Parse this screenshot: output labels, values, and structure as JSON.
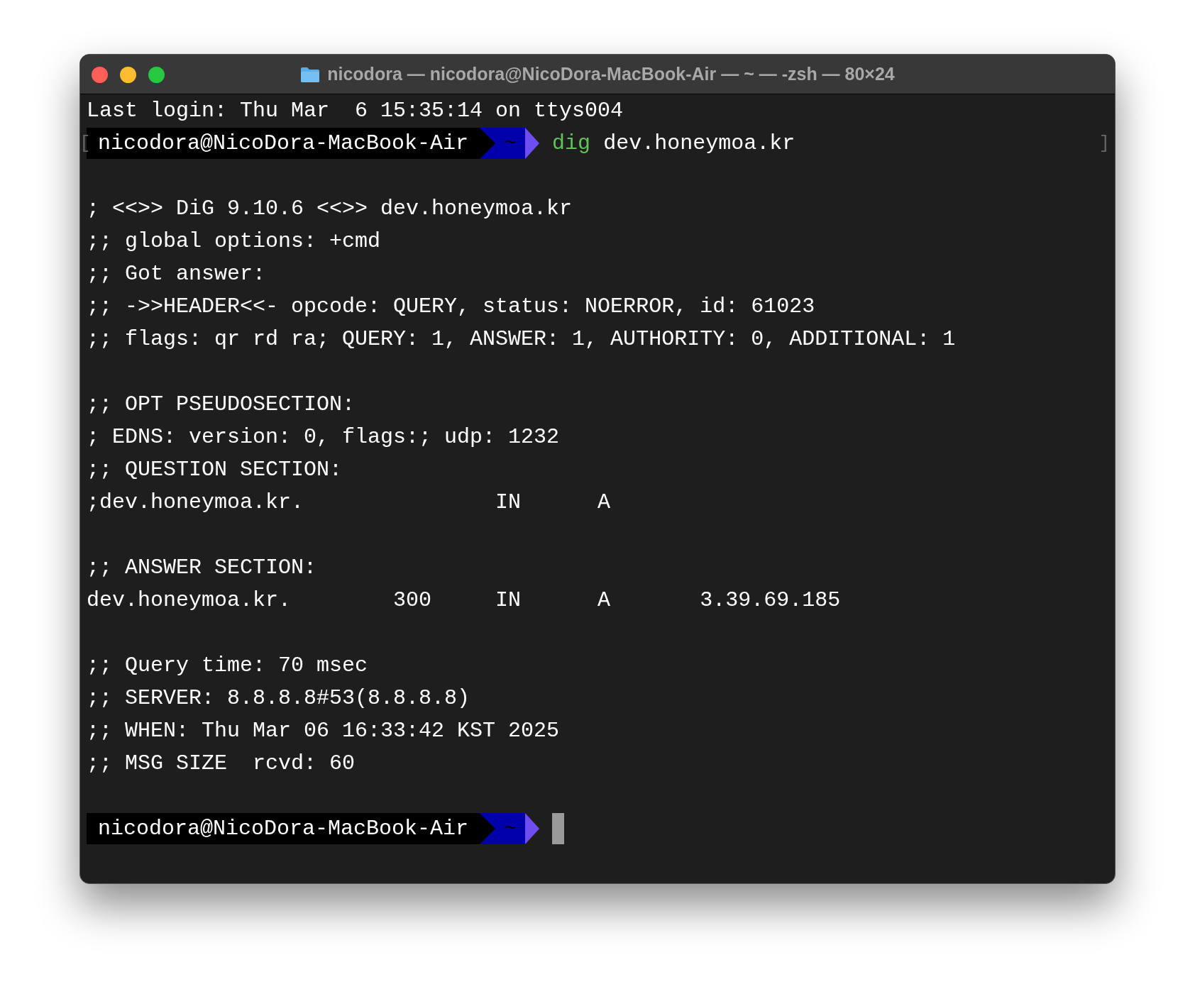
{
  "window": {
    "title": "nicodora — nicodora@NicoDora-MacBook-Air — ~ — -zsh — 80×24"
  },
  "lines": [
    {
      "kind": "text",
      "text": "Last login: Thu Mar  6 15:35:14 on ttys004"
    },
    {
      "kind": "prompt",
      "user": "nicodora@NicoDora-MacBook-Air",
      "dir": "~",
      "command": "dig",
      "args": "dev.honeymoa.kr",
      "mark_left": "[",
      "mark_right": "]",
      "cursor": false
    },
    {
      "kind": "blank"
    },
    {
      "kind": "text",
      "text": "; <<>> DiG 9.10.6 <<>> dev.honeymoa.kr"
    },
    {
      "kind": "text",
      "text": ";; global options: +cmd"
    },
    {
      "kind": "text",
      "text": ";; Got answer:"
    },
    {
      "kind": "text",
      "text": ";; ->>HEADER<<- opcode: QUERY, status: NOERROR, id: 61023"
    },
    {
      "kind": "text",
      "text": ";; flags: qr rd ra; QUERY: 1, ANSWER: 1, AUTHORITY: 0, ADDITIONAL: 1"
    },
    {
      "kind": "blank"
    },
    {
      "kind": "text",
      "text": ";; OPT PSEUDOSECTION:"
    },
    {
      "kind": "text",
      "text": "; EDNS: version: 0, flags:; udp: 1232"
    },
    {
      "kind": "text",
      "text": ";; QUESTION SECTION:"
    },
    {
      "kind": "text",
      "text": ";dev.honeymoa.kr.               IN      A"
    },
    {
      "kind": "blank"
    },
    {
      "kind": "text",
      "text": ";; ANSWER SECTION:"
    },
    {
      "kind": "text",
      "text": "dev.honeymoa.kr.        300     IN      A       3.39.69.185"
    },
    {
      "kind": "blank"
    },
    {
      "kind": "text",
      "text": ";; Query time: 70 msec"
    },
    {
      "kind": "text",
      "text": ";; SERVER: 8.8.8.8#53(8.8.8.8)"
    },
    {
      "kind": "text",
      "text": ";; WHEN: Thu Mar 06 16:33:42 KST 2025"
    },
    {
      "kind": "text",
      "text": ";; MSG SIZE  rcvd: 60"
    },
    {
      "kind": "blank"
    },
    {
      "kind": "prompt",
      "user": "nicodora@NicoDora-MacBook-Air",
      "dir": "~",
      "cursor": true
    }
  ]
}
